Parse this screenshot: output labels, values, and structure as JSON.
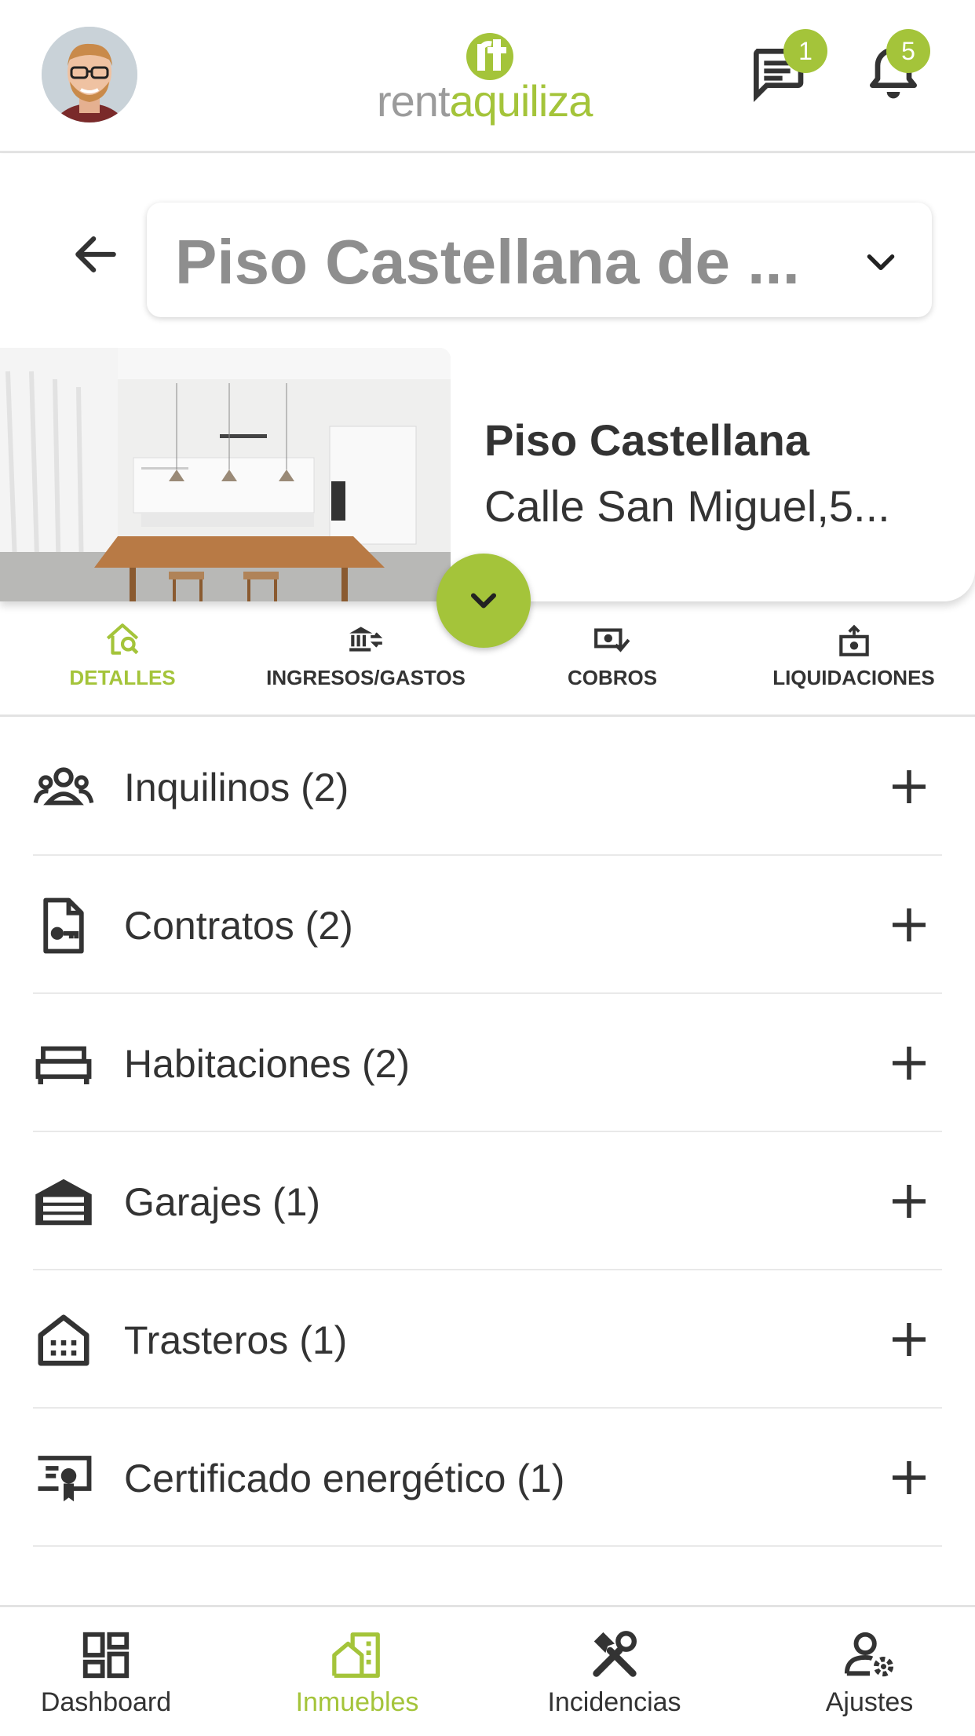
{
  "brand": {
    "part1": "rent",
    "part2": "aquiliza",
    "accent": "#a4c43a"
  },
  "header": {
    "messages_badge": "1",
    "notifications_badge": "5"
  },
  "property": {
    "selector_text": "Piso Castellana de ...",
    "name": "Piso Castellana",
    "address": "Calle San Miguel,5..."
  },
  "tabs": [
    {
      "label": "DETALLES",
      "icon": "home-search-icon",
      "active": true
    },
    {
      "label": "INGRESOS/GASTOS",
      "icon": "bank-transfer-icon",
      "active": false
    },
    {
      "label": "COBROS",
      "icon": "cash-check-icon",
      "active": false
    },
    {
      "label": "LIQUIDACIONES",
      "icon": "cash-register-icon",
      "active": false
    }
  ],
  "sections": [
    {
      "label": "Inquilinos (2)",
      "icon": "people-icon"
    },
    {
      "label": "Contratos (2)",
      "icon": "contract-key-icon"
    },
    {
      "label": "Habitaciones (2)",
      "icon": "bed-icon"
    },
    {
      "label": "Garajes (1)",
      "icon": "garage-icon"
    },
    {
      "label": "Trasteros (1)",
      "icon": "storage-building-icon"
    },
    {
      "label": "Certificado energético (1)",
      "icon": "certificate-icon"
    }
  ],
  "bottom_nav": [
    {
      "label": "Dashboard",
      "icon": "dashboard-icon",
      "active": false
    },
    {
      "label": "Inmuebles",
      "icon": "buildings-icon",
      "active": true
    },
    {
      "label": "Incidencias",
      "icon": "tools-icon",
      "active": false
    },
    {
      "label": "Ajustes",
      "icon": "user-settings-icon",
      "active": false
    }
  ]
}
